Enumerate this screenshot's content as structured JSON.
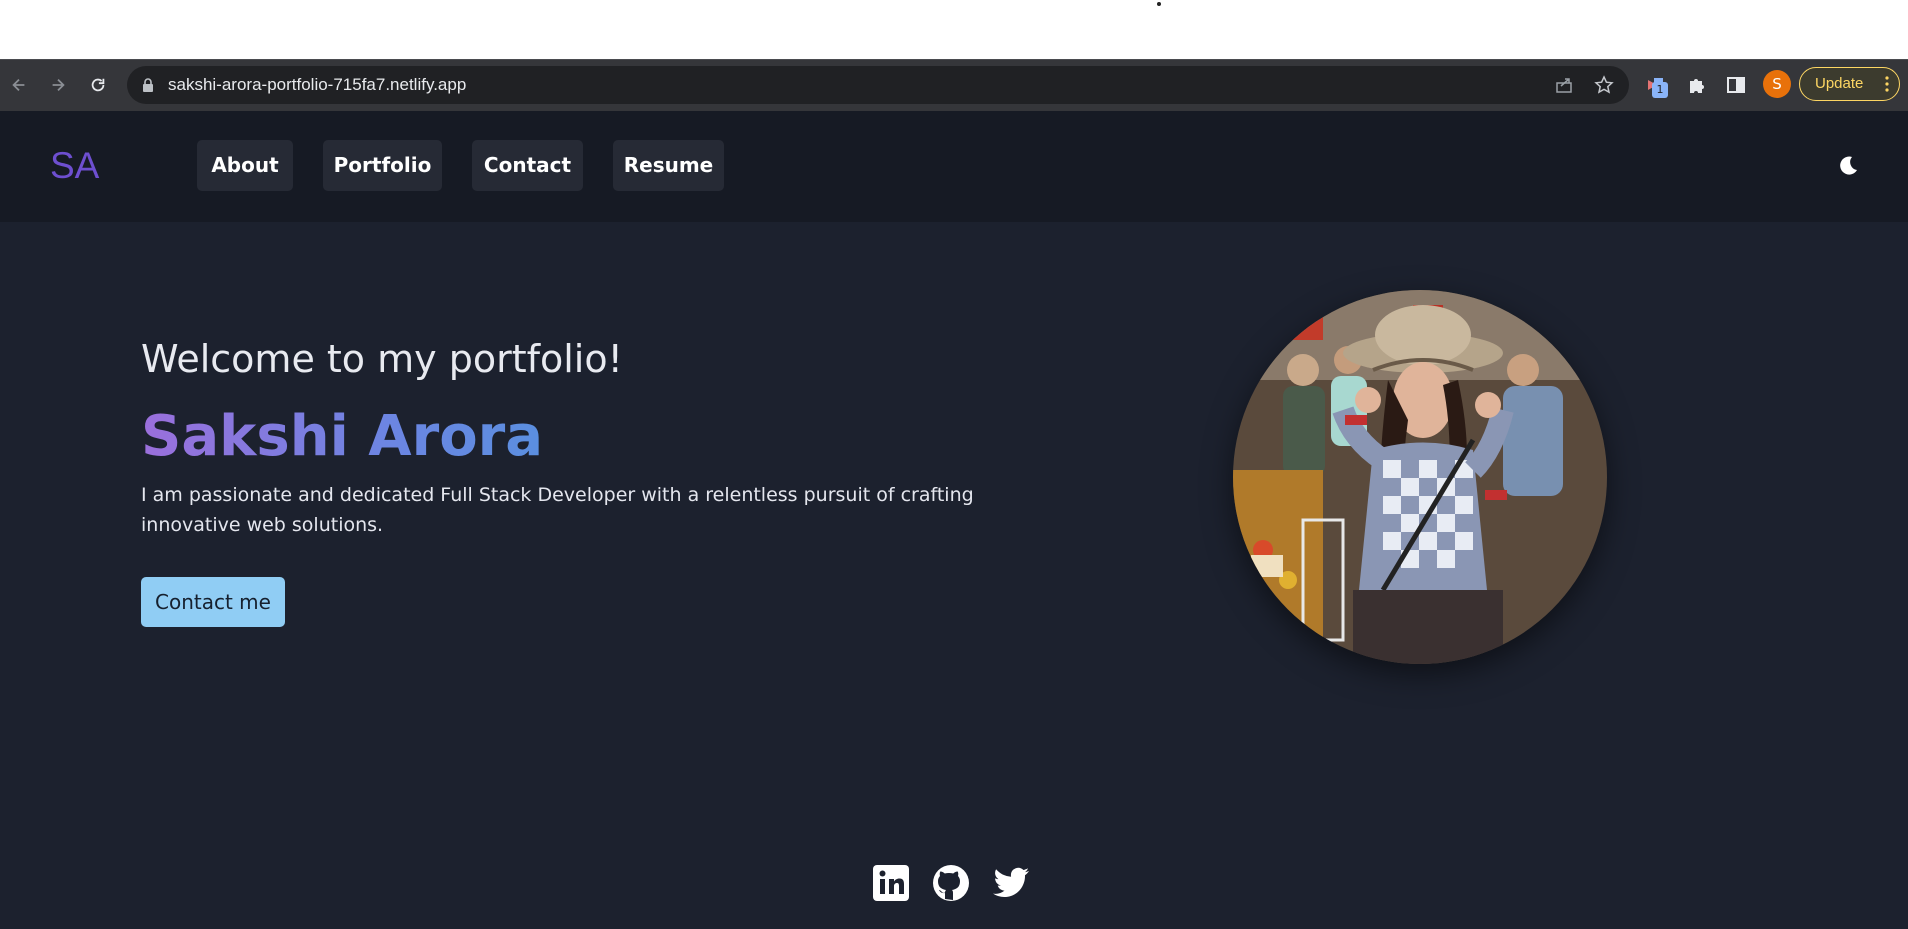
{
  "browser": {
    "url": "sakshi-arora-portfolio-715fa7.netlify.app",
    "extension_badge": "1",
    "profile_initial": "S",
    "update_label": "Update"
  },
  "site": {
    "logo": "SA",
    "nav": [
      {
        "label": "About"
      },
      {
        "label": "Portfolio"
      },
      {
        "label": "Contact"
      },
      {
        "label": "Resume"
      }
    ],
    "hero": {
      "welcome": "Welcome to my portfolio!",
      "name": "Sakshi Arora",
      "tagline": "I am passionate and dedicated Full Stack Developer with a relentless pursuit of crafting innovative web solutions.",
      "cta": "Contact me"
    },
    "social_icons": [
      "linkedin-icon",
      "github-icon",
      "twitter-icon"
    ]
  },
  "colors": {
    "header_bg": "#161a24",
    "page_bg": "#1c212e",
    "logo": "#6e4fd0",
    "cta_bg": "#90cdf4"
  }
}
